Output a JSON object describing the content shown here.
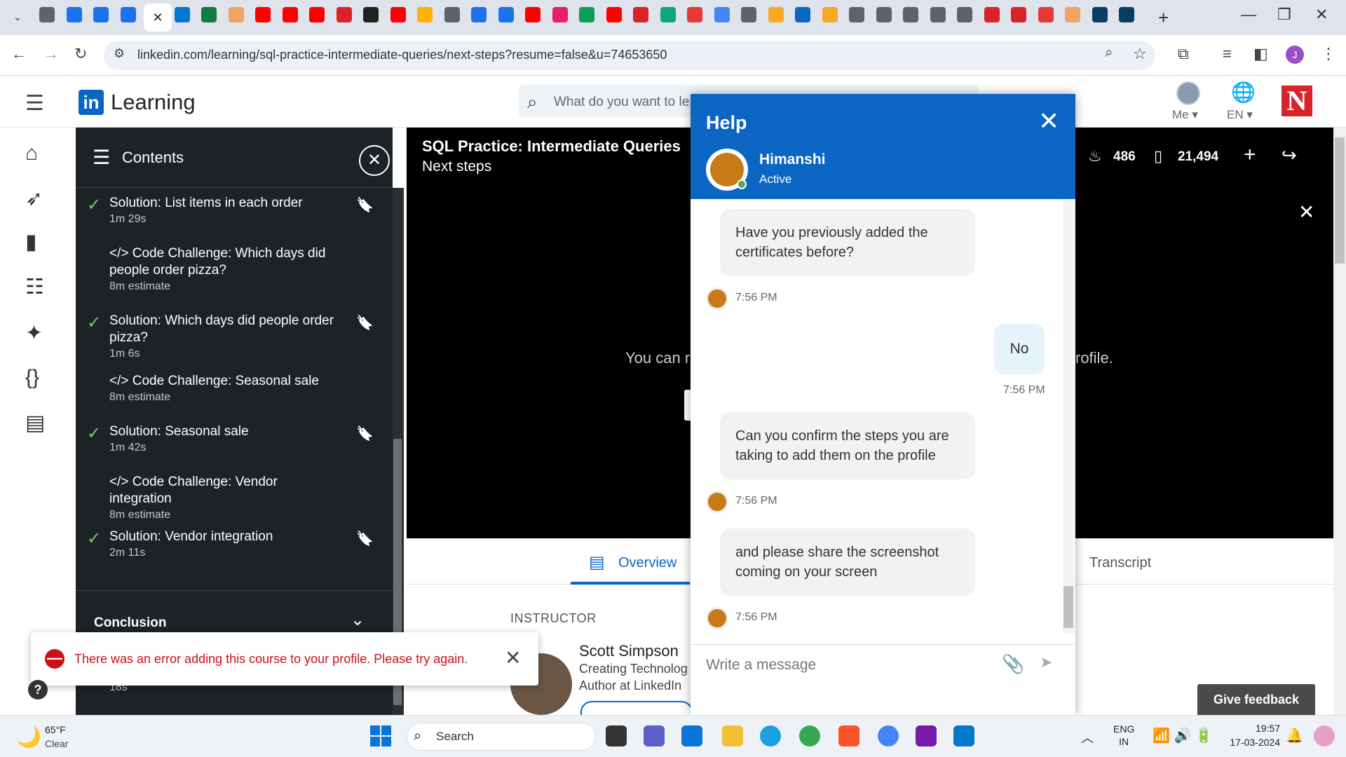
{
  "browser": {
    "active_tab_close": "✕",
    "new_tab": "+",
    "url": "linkedin.com/learning/sql-practice-intermediate-queries/next-steps?resume=false&u=74653650",
    "tab_colors": [
      "#5f6368",
      "#1a73e8",
      "#1a73e8",
      "#1a73e8",
      "#1e8e3e",
      "#0078d4",
      "#107c41",
      "#f4a261",
      "#ff0000",
      "#ff0000",
      "#ff0000",
      "#d8232a",
      "#222",
      "#ff0000",
      "#ffb300",
      "#5f6368",
      "#1a73e8",
      "#1a73e8",
      "#ff0000",
      "#e91e63",
      "#0f9d58",
      "#ff0000",
      "#d8232a",
      "#10a37f",
      "#e53935",
      "#4285f4",
      "#5f6368",
      "#f9a825",
      "#0a66c2",
      "#f9a825",
      "#5f6368",
      "#5f6368",
      "#5f6368",
      "#5f6368",
      "#5f6368",
      "#d8232a",
      "#d8232a",
      "#e53935",
      "#f4a261",
      "#0a3d62",
      "#0a3d62"
    ]
  },
  "header": {
    "logo_in": "in",
    "logo_text": "Learning",
    "search_placeholder": "What do you want to le",
    "me": "Me ▾",
    "lang": "EN ▾",
    "n_logo": "N"
  },
  "contents": {
    "title": "Contents",
    "items": [
      {
        "check": "✓",
        "title": "Solution: List items in each order",
        "sub": "1m 29s",
        "bookmark": true
      },
      {
        "check": "",
        "title": "</> Code Challenge: Which days did people order pizza?",
        "sub": "8m estimate",
        "bookmark": false
      },
      {
        "check": "✓",
        "title": "Solution: Which days did people order pizza?",
        "sub": "1m 6s",
        "bookmark": true
      },
      {
        "check": "",
        "title": "</> Code Challenge: Seasonal sale",
        "sub": "8m estimate",
        "bookmark": false
      },
      {
        "check": "✓",
        "title": "Solution: Seasonal sale",
        "sub": "1m 42s",
        "bookmark": true
      },
      {
        "check": "",
        "title": "</> Code Challenge: Vendor integration",
        "sub": "8m estimate",
        "bookmark": false
      },
      {
        "check": "✓",
        "title": "Solution: Vendor integration",
        "sub": "2m 11s",
        "bookmark": true
      }
    ],
    "conclusion": "Conclusion",
    "partial_duration": "18s"
  },
  "video": {
    "course_title": "SQL Practice: Intermediate Queries",
    "course_sub": "Next steps",
    "likes": "486",
    "saves": "21,494",
    "text_left": "You can r",
    "text_right": "rofile."
  },
  "overview": {
    "tab_overview": "Overview",
    "tab_transcript": "Transcript",
    "instructor_label": "INSTRUCTOR",
    "instructor_name": "Scott Simpson",
    "instructor_l1": "Creating Technolog",
    "instructor_l2": "Author at LinkedIn",
    "give_feedback": "Give feedback"
  },
  "toast": {
    "icon": "—",
    "message": "There was an error adding this course to your profile. Please try again.",
    "close": "✕"
  },
  "help": {
    "title": "Help",
    "agent_name": "Himanshi",
    "agent_status": "Active",
    "messages": [
      {
        "from": "agent",
        "text": "Have you previously added the certificates before?",
        "time": "7:56 PM"
      },
      {
        "from": "me",
        "text": "No",
        "time": "7:56 PM"
      },
      {
        "from": "agent",
        "text": "Can you confirm the steps you are taking to add them on the profile",
        "time": "7:56 PM"
      },
      {
        "from": "agent",
        "text": "and please share the screenshot coming on your screen",
        "time": "7:56 PM"
      }
    ],
    "input_placeholder": "Write a message"
  },
  "taskbar": {
    "temp": "65°F",
    "condition": "Clear",
    "search": "Search",
    "lang1": "ENG",
    "lang2": "IN",
    "time": "19:57",
    "date": "17-03-2024"
  }
}
